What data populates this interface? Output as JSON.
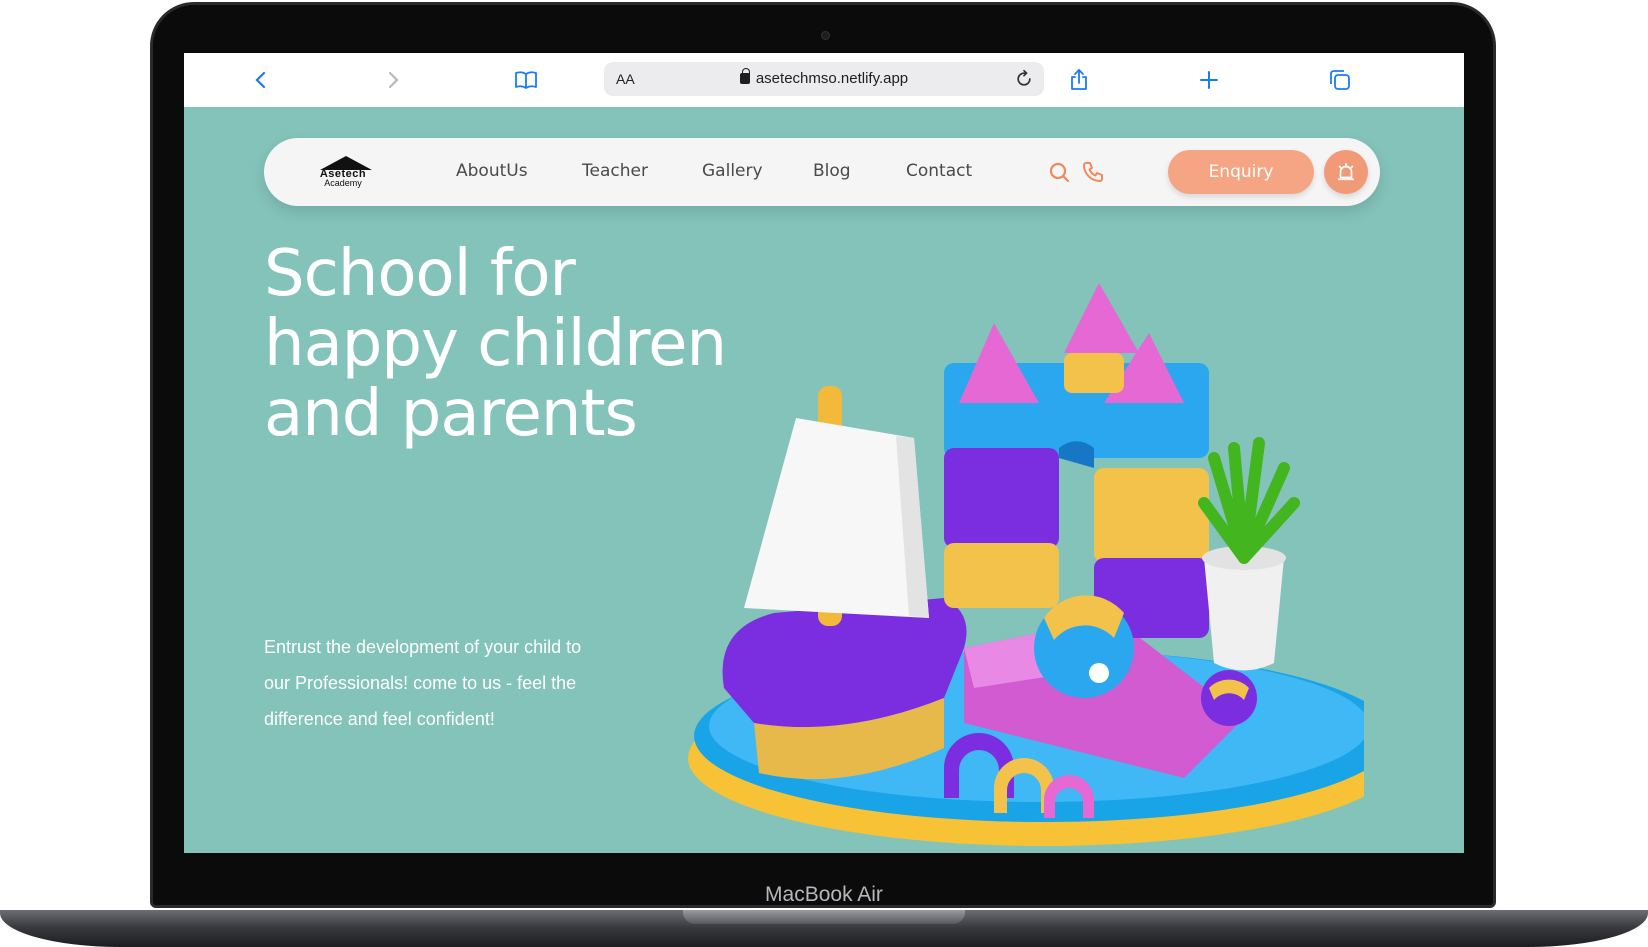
{
  "device": {
    "label": "MacBook Air"
  },
  "browser": {
    "reader_label": "AA",
    "url": "asetechmso.netlify.app"
  },
  "site": {
    "logo": {
      "line1": "Asetech",
      "line2": "Academy"
    },
    "nav": [
      "AboutUs",
      "Teacher",
      "Gallery",
      "Blog",
      "Contact"
    ],
    "enquiry_label": "Enquiry"
  },
  "hero": {
    "title": "School for happy children and parents",
    "subtitle": "Entrust the development of your child to our Professionals! come to us - feel the difference and feel confident!"
  },
  "colors": {
    "background": "#83c3ba",
    "accent": "#f5a584",
    "icon_accent": "#ef8a5a",
    "browser_blue": "#1a7cf5"
  },
  "icons": {
    "browser": [
      "back-icon",
      "forward-icon",
      "bookmarks-icon",
      "reload-icon",
      "share-icon",
      "new-tab-icon",
      "tabs-icon"
    ],
    "nav": [
      "search-icon",
      "phone-icon",
      "bell-icon"
    ]
  }
}
